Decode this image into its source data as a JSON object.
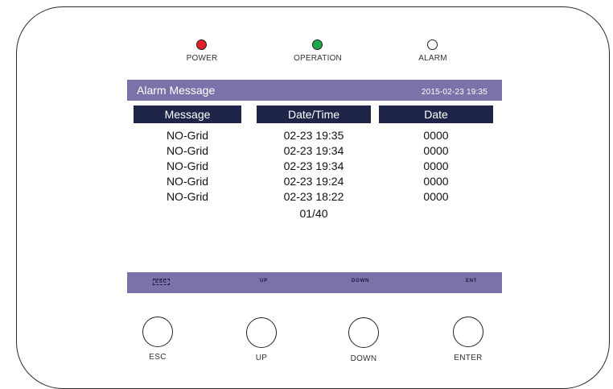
{
  "indicators": [
    {
      "label": "POWER",
      "color": "#e0202a"
    },
    {
      "label": "OPERATION",
      "color": "#1fa54a"
    },
    {
      "label": "ALARM",
      "color": "#ffffff"
    }
  ],
  "screen": {
    "title": "Alarm Message",
    "datetime": "2015-02-23  19:35",
    "columns": [
      "Message",
      "Date/Time",
      "Date"
    ],
    "rows": [
      {
        "message": "NO-Grid",
        "datetime": "02-23  19:35",
        "date": "0000"
      },
      {
        "message": "NO-Grid",
        "datetime": "02-23  19:34",
        "date": "0000"
      },
      {
        "message": "NO-Grid",
        "datetime": "02-23  19:34",
        "date": "0000"
      },
      {
        "message": "NO-Grid",
        "datetime": "02-23  19:24",
        "date": "0000"
      },
      {
        "message": "NO-Grid",
        "datetime": "02-23  18:22",
        "date": "0000"
      }
    ],
    "page": "01/40",
    "footer": {
      "esc": "ESC",
      "up": "UP",
      "down": "DOWN",
      "ent": "ENT"
    }
  },
  "buttons": [
    "ESC",
    "UP",
    "DOWN",
    "ENTER"
  ]
}
